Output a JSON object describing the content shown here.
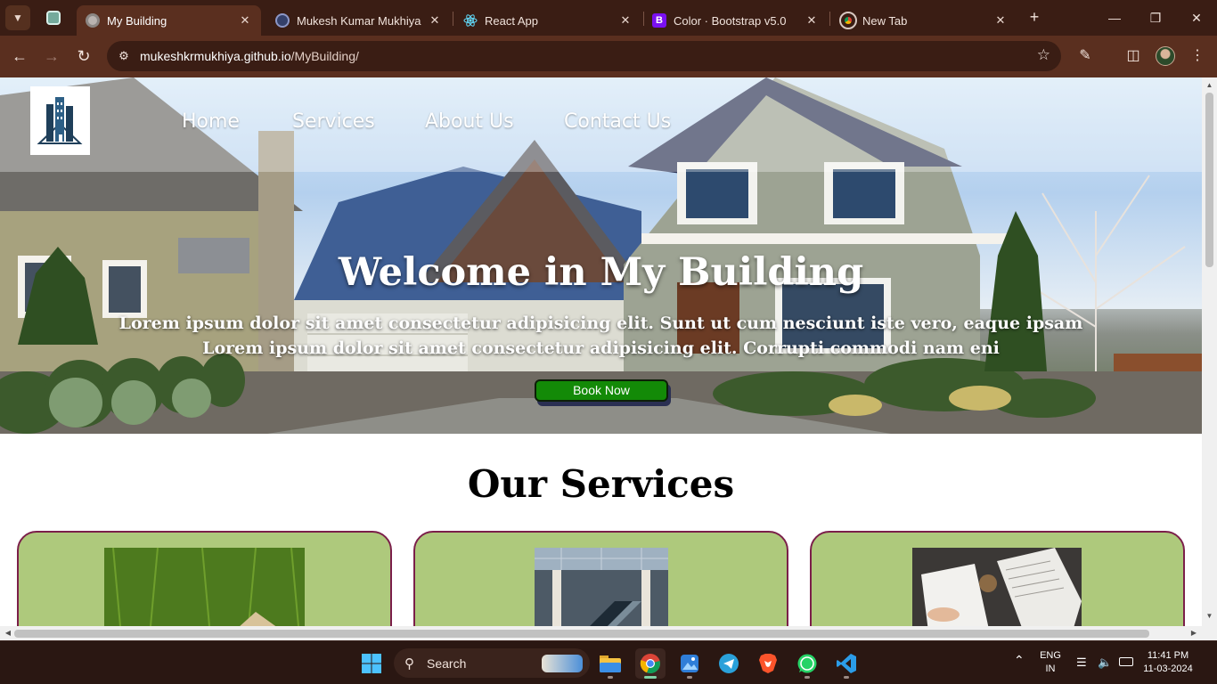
{
  "browser": {
    "tabs": [
      {
        "title": "My Building",
        "active": true
      },
      {
        "title": "Mukesh Kumar Mukhiya",
        "active": false
      },
      {
        "title": "React App",
        "active": false
      },
      {
        "title": "Color · Bootstrap v5.0",
        "active": false
      },
      {
        "title": "New Tab",
        "active": false
      }
    ],
    "bootstrap_fav": "B",
    "url_domain": "mukeshkrmukhiya.github.io",
    "url_path": "/MyBuilding/"
  },
  "site": {
    "nav": [
      "Home",
      "Services",
      "About Us",
      "Contact Us"
    ],
    "hero_title": "Welcome in My Building",
    "hero_line1": "Lorem ipsum dolor sit amet consectetur adipisicing elit. Sunt ut cum nesciunt iste vero, eaque ipsam",
    "hero_line2": "Lorem ipsum dolor sit amet consectetur adipisicing elit. Corrupti commodi nam eni",
    "book_button": "Book Now",
    "services_title": "Our Services",
    "colors": {
      "card_bg": "#aec97c",
      "card_border": "#7b1f4a",
      "button_bg": "#138a07"
    }
  },
  "taskbar": {
    "search_placeholder": "Search",
    "language": "ENG",
    "region": "IN",
    "time": "11:41 PM",
    "date": "11-03-2024"
  }
}
